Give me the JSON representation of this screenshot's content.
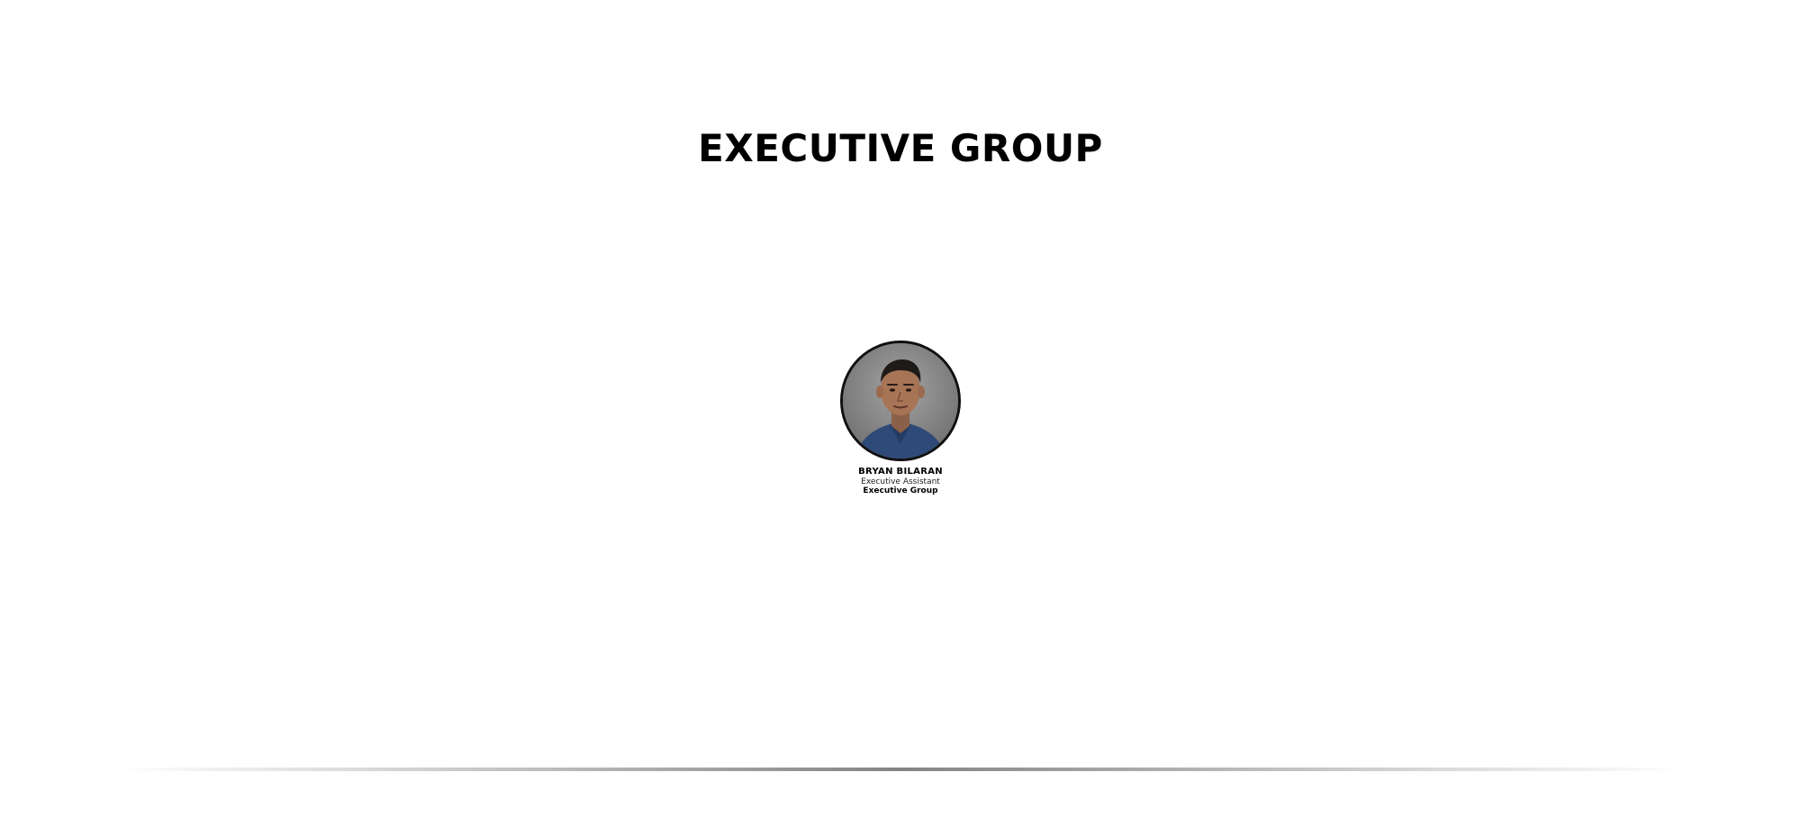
{
  "section": {
    "title": "EXECUTIVE GROUP"
  },
  "members": [
    {
      "name": "BRYAN BILARAN",
      "role": "Executive Assistant",
      "group": "Executive Group"
    }
  ]
}
